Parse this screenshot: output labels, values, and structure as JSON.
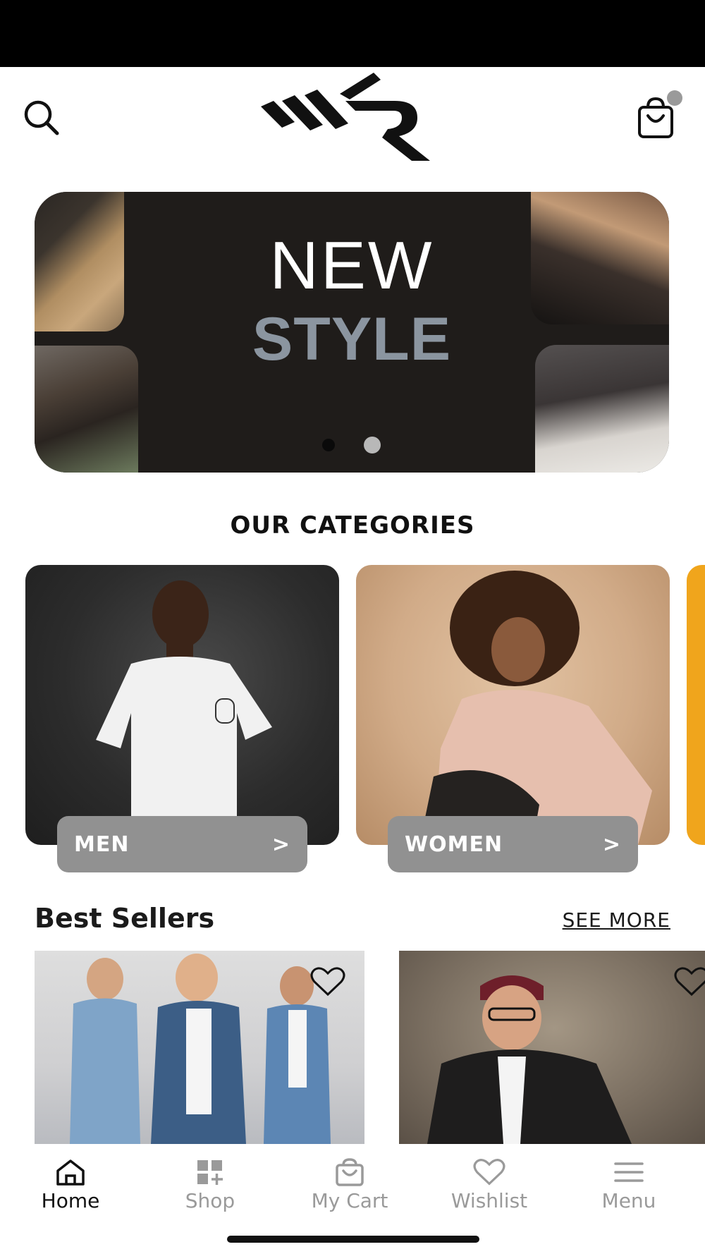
{
  "header": {
    "search_icon": "search-icon",
    "logo": "WKR",
    "cart_icon": "shopping-bag-icon"
  },
  "banner": {
    "line1": "NEW",
    "line2": "STYLE",
    "line2_color": "#8b95a0",
    "slides_total": 2,
    "active_slide": 1
  },
  "categories": {
    "title": "OUR CATEGORIES",
    "items": [
      {
        "label": "MEN",
        "arrow": ">"
      },
      {
        "label": "WOMEN",
        "arrow": ">"
      }
    ]
  },
  "best_sellers": {
    "title": "Best Sellers",
    "see_more": "SEE MORE"
  },
  "bottom_nav": {
    "items": [
      {
        "label": "Home",
        "icon": "home-icon",
        "active": true
      },
      {
        "label": "Shop",
        "icon": "grid-plus-icon",
        "active": false
      },
      {
        "label": "My Cart",
        "icon": "shopping-bag-icon",
        "active": false
      },
      {
        "label": "Wishlist",
        "icon": "heart-icon",
        "active": false
      },
      {
        "label": "Menu",
        "icon": "hamburger-icon",
        "active": false
      }
    ]
  },
  "colors": {
    "status_bar": "#000000",
    "button_gray": "#919191",
    "nav_inactive": "#9a9a9a",
    "nav_active": "#111111"
  }
}
